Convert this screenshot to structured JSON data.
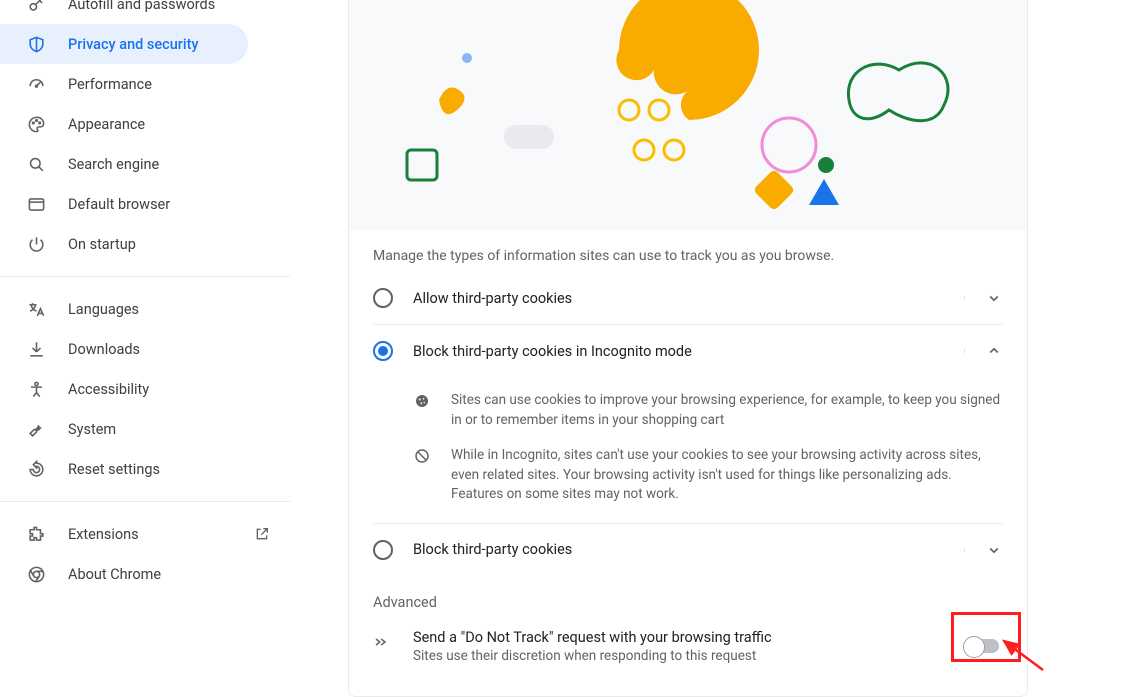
{
  "sidebar": {
    "items": [
      {
        "label": "Autofill and passwords"
      },
      {
        "label": "Privacy and security"
      },
      {
        "label": "Performance"
      },
      {
        "label": "Appearance"
      },
      {
        "label": "Search engine"
      },
      {
        "label": "Default browser"
      },
      {
        "label": "On startup"
      }
    ],
    "items2": [
      {
        "label": "Languages"
      },
      {
        "label": "Downloads"
      },
      {
        "label": "Accessibility"
      },
      {
        "label": "System"
      },
      {
        "label": "Reset settings"
      }
    ],
    "items3": [
      {
        "label": "Extensions"
      },
      {
        "label": "About Chrome"
      }
    ]
  },
  "main": {
    "intro": "Manage the types of information sites can use to track you as you browse.",
    "options": [
      {
        "label": "Allow third-party cookies"
      },
      {
        "label": "Block third-party cookies in Incognito mode"
      },
      {
        "label": "Block third-party cookies"
      }
    ],
    "details": [
      "Sites can use cookies to improve your browsing experience, for example, to keep you signed in or to remember items in your shopping cart",
      "While in Incognito, sites can't use your cookies to see your browsing activity across sites, even related sites. Your browsing activity isn't used for things like personalizing ads. Features on some sites may not work."
    ],
    "advanced_label": "Advanced",
    "dnt": {
      "title": "Send a \"Do Not Track\" request with your browsing traffic",
      "sub": "Sites use their discretion when responding to this request"
    }
  }
}
